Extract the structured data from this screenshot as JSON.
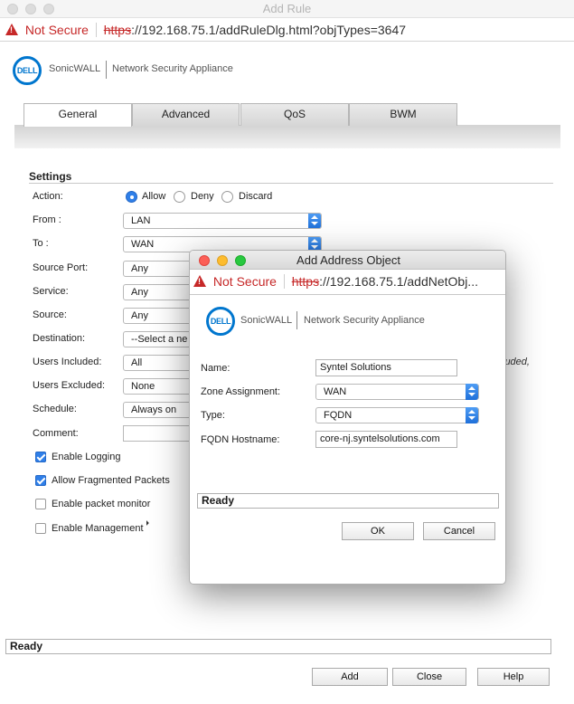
{
  "window": {
    "title": "Add Rule",
    "security_label": "Not Secure",
    "url_scheme": "https",
    "url_rest": "://192.168.75.1/addRuleDlg.html?objTypes=3647"
  },
  "brand": {
    "logo_text": "DELL",
    "product": "SonicWALL",
    "subtitle": "Network Security Appliance"
  },
  "tabs": [
    "General",
    "Advanced",
    "QoS",
    "BWM"
  ],
  "settings": {
    "heading": "Settings",
    "action": {
      "label": "Action:",
      "options": [
        "Allow",
        "Deny",
        "Discard"
      ],
      "selected": "Allow"
    },
    "from": {
      "label": "From :",
      "value": "LAN"
    },
    "to": {
      "label": "To :",
      "value": "WAN"
    },
    "source_port": {
      "label": "Source Port:",
      "value": "Any"
    },
    "service": {
      "label": "Service:",
      "value": "Any"
    },
    "source": {
      "label": "Source:",
      "value": "Any"
    },
    "destination": {
      "label": "Destination:",
      "value": "--Select a ne"
    },
    "users_included": {
      "label": "Users Included:",
      "value": "All",
      "note": "luded,"
    },
    "users_excluded": {
      "label": "Users Excluded:",
      "value": "None"
    },
    "schedule": {
      "label": "Schedule:",
      "value": "Always on"
    },
    "comment": {
      "label": "Comment:",
      "value": ""
    },
    "checkboxes": [
      {
        "label": "Enable Logging",
        "checked": true
      },
      {
        "label": "Allow Fragmented Packets",
        "checked": true
      },
      {
        "label": "Enable packet monitor",
        "checked": false
      },
      {
        "label": "Enable Management",
        "checked": false
      }
    ]
  },
  "status": "Ready",
  "buttons": {
    "add": "Add",
    "close": "Close",
    "help": "Help"
  },
  "dialog": {
    "title": "Add Address Object",
    "security_label": "Not Secure",
    "url_scheme": "https",
    "url_rest": "://192.168.75.1/addNetObj...",
    "name": {
      "label": "Name:",
      "value": "Syntel Solutions"
    },
    "zone": {
      "label": "Zone Assignment:",
      "value": "WAN"
    },
    "type": {
      "label": "Type:",
      "value": "FQDN"
    },
    "fqdn": {
      "label": "FQDN Hostname:",
      "value": "core-nj.syntelsolutions.com"
    },
    "status": "Ready",
    "ok_label": "OK",
    "cancel_label": "Cancel"
  },
  "colors": {
    "accent": "#2f7fe8",
    "warning": "#c62828",
    "dell_blue": "#0076ce",
    "traffic_close": "#fc5f57",
    "traffic_min": "#fdbc2e",
    "traffic_max": "#28c840"
  }
}
